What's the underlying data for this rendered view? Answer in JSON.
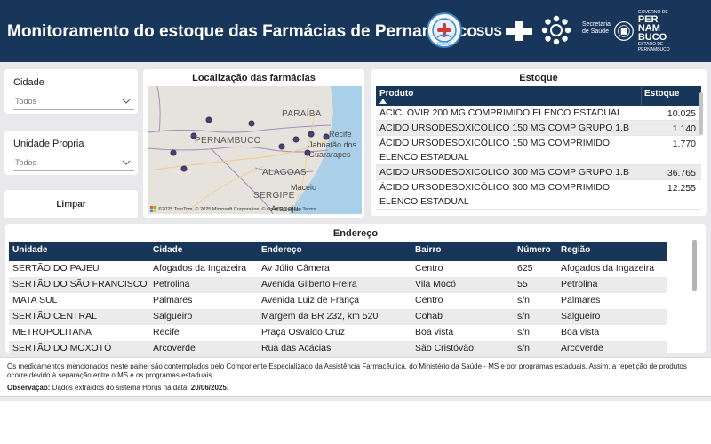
{
  "header": {
    "title": "Monitoramento do estoque das Farmácias de Pernambuco",
    "logos": {
      "cesaf": "CESAF",
      "sus": "SUS",
      "secretaria": "Secretaria de Saúde",
      "pernambuco": [
        "PER",
        "NAM",
        "BUCO"
      ],
      "pernambuco_sub": "ESTADO DE PERNAMBUCO",
      "governo": "GOVERNO DE"
    },
    "background_color": "#18365a"
  },
  "filters": {
    "cidade": {
      "label": "Cidade",
      "value": "Todos"
    },
    "unidade": {
      "label": "Unidade Propria",
      "value": "Todos"
    },
    "clear_label": "Limpar"
  },
  "map": {
    "title": "Localização das farmácias",
    "labels": {
      "paraiba": "PARAÍBA",
      "pernambuco": "PERNAMBUCO",
      "alagoas": "ALAGOAS",
      "sergipe": "SERGIPE",
      "recife": "Recife",
      "jaboatao": "Jaboatão dos",
      "guararapes": "Guararapes",
      "maceio": "Maceio",
      "aracaju": "Aracaju"
    },
    "attribution": "©2025 TomTom, © 2025 Microsoft Corporation, © OpenStreetMap  Terms",
    "marker_color": "#4d3f73"
  },
  "stock": {
    "title": "Estoque",
    "columns": [
      "Produto",
      "Estoque"
    ],
    "rows": [
      {
        "produto": "ACICLOVIR 200 MG COMPRIMIDO ELENCO ESTADUAL",
        "estoque": "10.025"
      },
      {
        "produto": "ACIDO URSODESOXICOLICO 150 MG COMP GRUPO 1.B",
        "estoque": "1.140"
      },
      {
        "produto": "ÁCIDO URSODESOXICÓLICO 150 MG COMPRIMIDO ELENCO ESTADUAL",
        "estoque": "1.770"
      },
      {
        "produto": "ACIDO URSODESOXICOLICO 300 MG COMP GRUPO 1.B",
        "estoque": "36.765"
      },
      {
        "produto": "ÁCIDO URSODESOXICÓLICO 300 MG COMPRIMIDO ELENCO ESTADUAL",
        "estoque": "12.255"
      }
    ]
  },
  "addresses": {
    "title": "Endereço",
    "columns": [
      "Unidade",
      "Cidade",
      "Endereço",
      "Bairro",
      "Número",
      "Região"
    ],
    "rows": [
      [
        "SERTÃO DO PAJEU",
        "Afogados da Ingazeira",
        "Av Júlio Câmera",
        "Centro",
        "625",
        "Afogados da Ingazeira"
      ],
      [
        "SERTÃO DO SÃO FRANCISCO",
        "Petrolina",
        "Avenida Gilberto Freira",
        "Vila Mocó",
        "55",
        "Petrolina"
      ],
      [
        "MATA SUL",
        "Palmares",
        "Avenida Luiz de França",
        "Centro",
        "s/n",
        "Palmares"
      ],
      [
        "SERTÃO CENTRAL",
        "Salgueiro",
        "Margem da BR 232, km 520",
        "Cohab",
        "s/n",
        "Salgueiro"
      ],
      [
        "METROPOLITANA",
        "Recife",
        "Praça Osvaldo Cruz",
        "Boa vista",
        "s/n",
        "Boa vista"
      ],
      [
        "SERTÃO DO MOXOTÓ",
        "Arcoverde",
        "Rua das Acácias",
        "São Cristóvão",
        "s/n",
        "Arcoverde"
      ]
    ]
  },
  "footer": {
    "text": "Os medicamentos mencionados neste painel são contemplados pelo Componente Especializado da Assistência Farmacêutica, do Ministério da Saúde - MS e por programas estaduais. Assim, a repetição de produtos ocorre devido à separação entre o MS e os programas estaduais.",
    "obs_label": "Observação:",
    "obs_text": " Dados extraídos do sistema Hórus na data: ",
    "obs_date": "20/06/2025."
  }
}
